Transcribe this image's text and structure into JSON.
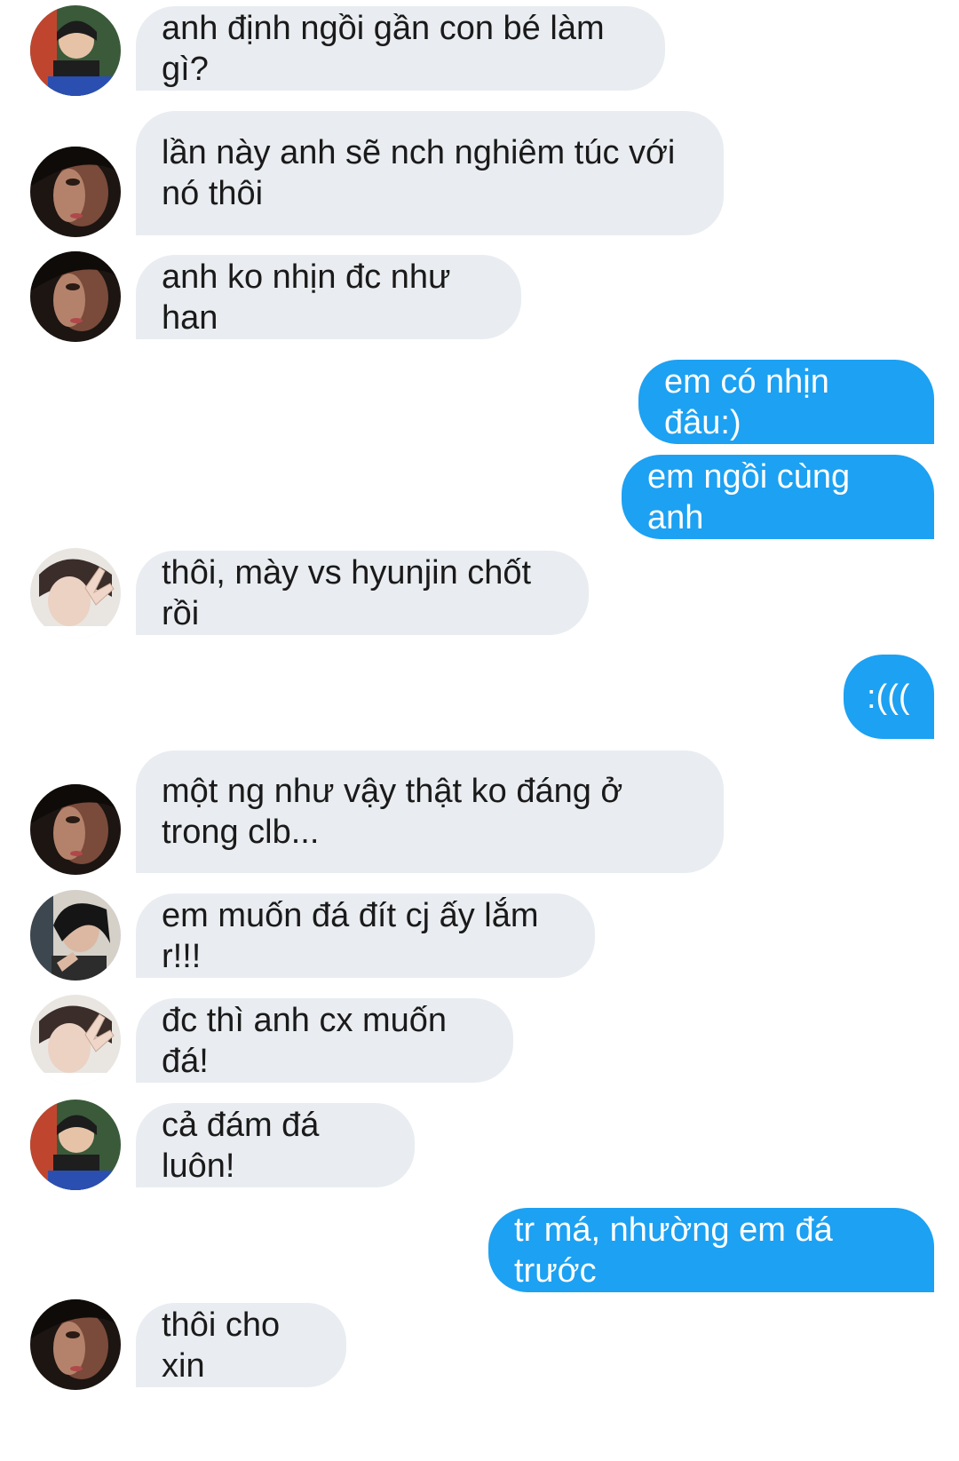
{
  "messages": [
    {
      "text": "anh định ngồi gần con bé làm gì?",
      "direction": "incoming",
      "avatar": "avatar-boy-green-bg"
    },
    {
      "text": "lần này anh sẽ nch nghiêm túc với nó thôi",
      "direction": "incoming",
      "avatar": "avatar-dark-closeup"
    },
    {
      "text": "anh ko nhịn đc như han",
      "direction": "incoming",
      "avatar": "avatar-dark-closeup"
    },
    {
      "text": "em có nhịn đâu:)",
      "direction": "outgoing"
    },
    {
      "text": "em ngồi cùng anh",
      "direction": "outgoing"
    },
    {
      "text": "thôi, mày vs hyunjin chốt rồi",
      "direction": "incoming",
      "avatar": "avatar-peace-sign"
    },
    {
      "text": ":(((",
      "direction": "outgoing"
    },
    {
      "text": "một ng như vậy thật ko đáng ở trong clb...",
      "direction": "incoming",
      "avatar": "avatar-dark-closeup"
    },
    {
      "text": "em muốn đá đít cj ấy lắm r!!!",
      "direction": "incoming",
      "avatar": "avatar-boy-dark-hair"
    },
    {
      "text": "đc thì anh cx muốn đá!",
      "direction": "incoming",
      "avatar": "avatar-peace-sign"
    },
    {
      "text": "cả đám đá luôn!",
      "direction": "incoming",
      "avatar": "avatar-boy-green-bg"
    },
    {
      "text": "tr má, nhường em đá trước",
      "direction": "outgoing"
    },
    {
      "text": "thôi cho xin",
      "direction": "incoming",
      "avatar": "avatar-dark-closeup"
    }
  ],
  "colors": {
    "incoming_bubble": "#e9ecf0",
    "outgoing_bubble": "#1da1f2",
    "incoming_text": "#1a1a1a",
    "outgoing_text": "#ffffff"
  }
}
